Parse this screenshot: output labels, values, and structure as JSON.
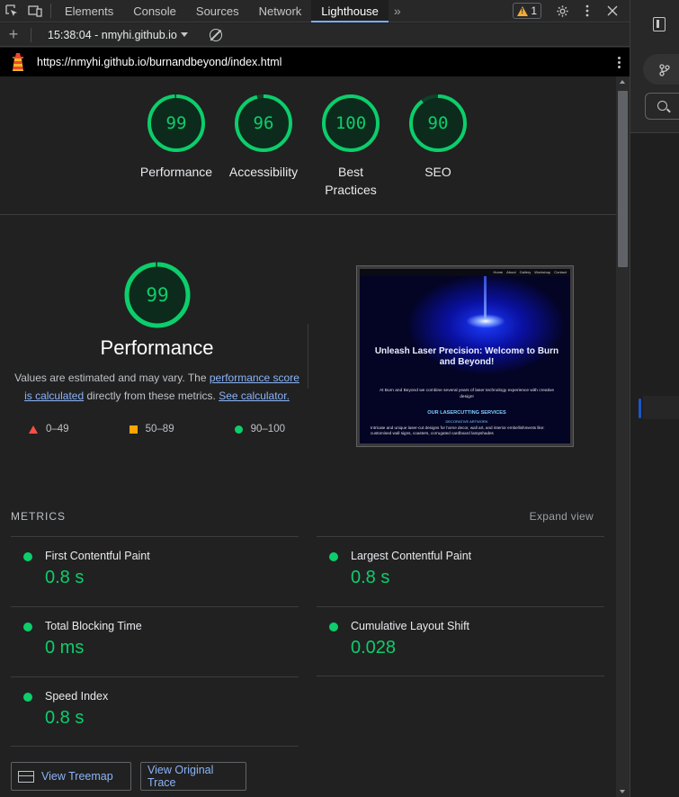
{
  "devtools": {
    "tabs": [
      "Elements",
      "Console",
      "Sources",
      "Network",
      "Lighthouse"
    ],
    "active_tab": "Lighthouse",
    "warning_count": "1"
  },
  "toolbar": {
    "report_label": "15:38:04 - nmyhi.github.io"
  },
  "url": "https://nmyhi.github.io/burnandbeyond/index.html",
  "scores": [
    {
      "label": "Performance",
      "value": "99",
      "score": 99
    },
    {
      "label": "Accessibility",
      "value": "96",
      "score": 96
    },
    {
      "label": "Best Practices",
      "value": "100",
      "score": 100
    },
    {
      "label": "SEO",
      "value": "90",
      "score": 90
    }
  ],
  "performance": {
    "score_text": "99",
    "score": 99,
    "title": "Performance",
    "desc_prefix": "Values are estimated and may vary. The ",
    "desc_link1": "performance score is calculated",
    "desc_middle": " directly from these metrics. ",
    "desc_link2": "See calculator.",
    "legend": {
      "fail": "0–49",
      "average": "50–89",
      "pass": "90–100"
    }
  },
  "screenshot": {
    "nav": [
      "Home",
      "About",
      "Gallery",
      "Workshop",
      "Contact"
    ],
    "heading": "Unleash Laser Precision: Welcome to Burn and Beyond!",
    "intro": "At Burn and Beyond we combine several years of laser technology experience with creative design!",
    "services_heading": "OUR LASERCUTTING SERVICES",
    "services_sub": "DECORATIVE ARTWORK",
    "services_text": "Intricate and unique laser-cut designs for home decor, wall art, and interior embellishments like: customised wall signs, coasters, corrugated cardboard lampshades"
  },
  "metrics": {
    "heading": "METRICS",
    "expand_label": "Expand view",
    "items": [
      {
        "name": "First Contentful Paint",
        "value": "0.8 s"
      },
      {
        "name": "Largest Contentful Paint",
        "value": "0.8 s"
      },
      {
        "name": "Total Blocking Time",
        "value": "0 ms"
      },
      {
        "name": "Cumulative Layout Shift",
        "value": "0.028"
      },
      {
        "name": "Speed Index",
        "value": "0.8 s"
      }
    ]
  },
  "buttons": {
    "treemap": "View Treemap",
    "trace": "View Original Trace"
  },
  "colors": {
    "pass": "#0cce6b",
    "average": "#ffa400",
    "fail": "#ff4e42",
    "link": "#8ab4f8"
  }
}
